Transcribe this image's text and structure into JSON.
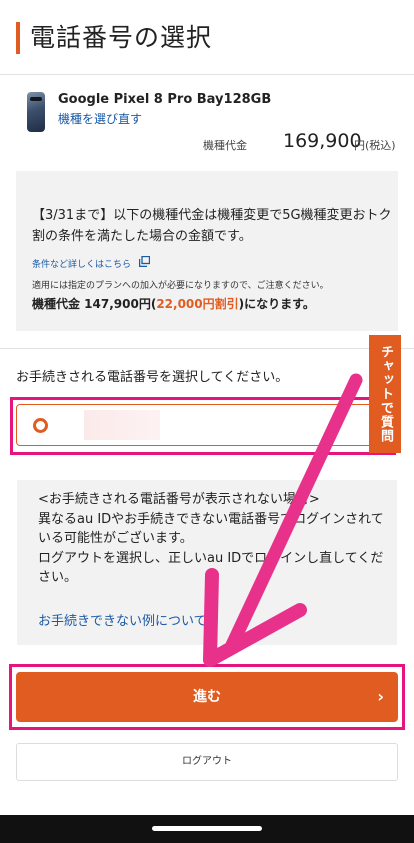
{
  "header": {
    "title": "電話番号の選択"
  },
  "product": {
    "name": "Google Pixel 8 Pro Bay128GB",
    "change_link": "機種を選び直す",
    "price_label": "機種代金",
    "price_value": "169,900",
    "price_unit": "円(税込)"
  },
  "notice": {
    "text": "【3/31まで】以下の機種代金は機種変更で5G機種変更おトク割の条件を満たした場合の金額です。",
    "conditions_link": "条件など詳しくはこちら",
    "small_note": "適用には指定のプランへの加入が必要になりますので、ご注意ください。",
    "discount_prefix": "機種代金 147,900円(",
    "discount_amount": "22,000円割引",
    "discount_suffix": ")になります。"
  },
  "selection": {
    "prompt": "お手続きされる電話番号を選択してください。"
  },
  "chat_tab": {
    "label": "チャットで質問"
  },
  "info": {
    "text": "<お手続きされる電話番号が表示されない場合>\n異なるau IDやお手続きできない電話番号でログインされている可能性がございます。\nログアウトを選択し、正しいau IDでログインし直してください。",
    "link": "お手続きできない例について"
  },
  "buttons": {
    "proceed": "進む",
    "logout": "ログアウト"
  },
  "colors": {
    "accent": "#e05c20",
    "link": "#1a5aa6",
    "highlight": "#e6157d"
  }
}
